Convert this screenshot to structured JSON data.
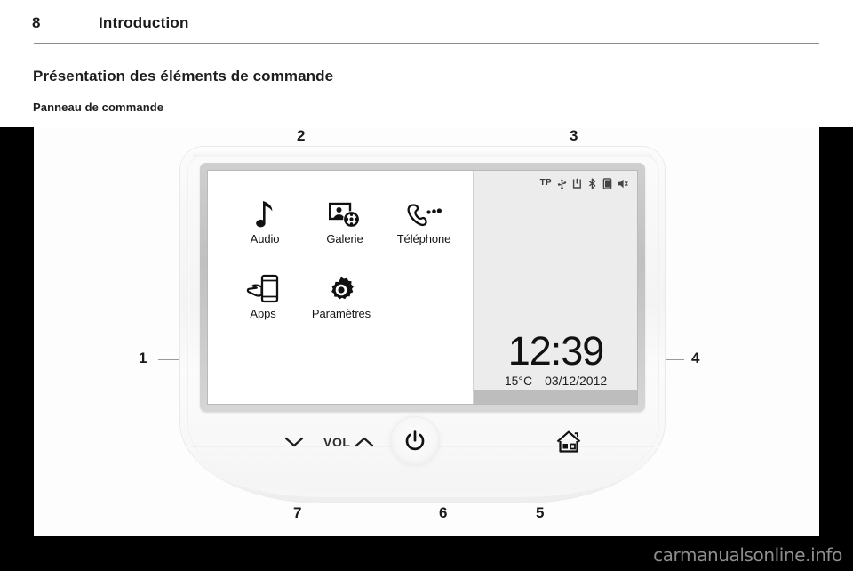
{
  "document": {
    "page_number": "8",
    "section": "Introduction",
    "title": "Présentation des éléments de commande",
    "subtitle": "Panneau de commande"
  },
  "watermark": "carmanualsonline.info",
  "figure": {
    "callouts": [
      {
        "id": "1",
        "label": "1"
      },
      {
        "id": "2",
        "label": "2"
      },
      {
        "id": "3",
        "label": "3"
      },
      {
        "id": "4",
        "label": "4"
      },
      {
        "id": "5",
        "label": "5"
      },
      {
        "id": "6",
        "label": "6"
      },
      {
        "id": "7",
        "label": "7"
      }
    ]
  },
  "device": {
    "screen": {
      "apps": [
        {
          "icon": "music-note-icon",
          "label": "Audio"
        },
        {
          "icon": "gallery-photo-film-icon",
          "label": "Galerie"
        },
        {
          "icon": "phone-handset-icon",
          "label": "Téléphone"
        },
        {
          "icon": "hand-smartphone-icon",
          "label": "Apps"
        },
        {
          "icon": "gear-icon",
          "label": "Paramètres"
        }
      ],
      "status_bar": {
        "tp_label": "TP",
        "icons": [
          "usb-icon",
          "sd-card-icon",
          "bluetooth-icon",
          "phone-battery-icon",
          "speaker-mute-icon"
        ]
      },
      "info_panel": {
        "time": "12:39",
        "temperature": "15°C",
        "date": "03/12/2012"
      }
    },
    "controls": {
      "volume_down_icon": "chevron-down-icon",
      "volume_label": "VOL",
      "volume_up_icon": "chevron-up-icon",
      "power_icon": "power-icon",
      "home_icon": "home-icon"
    }
  }
}
